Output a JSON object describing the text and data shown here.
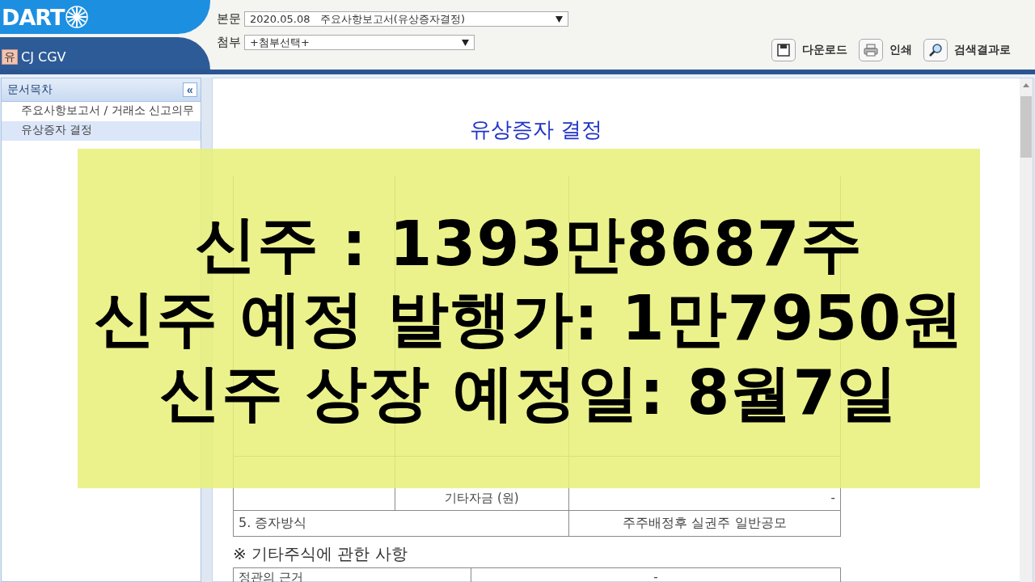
{
  "header": {
    "logo": "DART",
    "company": {
      "badge": "유",
      "name": "CJ CGV"
    },
    "selects": [
      {
        "label": "본문",
        "value": "2020.05.08   주요사항보고서(유상증자결정)",
        "kind": "wide"
      },
      {
        "label": "첨부",
        "value": "+첨부선택+",
        "kind": "narrow"
      }
    ],
    "buttons": [
      {
        "label": "다운로드",
        "kind": "save"
      },
      {
        "label": "인쇄",
        "kind": "print"
      },
      {
        "label": "검색결과로",
        "kind": "search"
      }
    ]
  },
  "sidebar": {
    "title": "문서목차",
    "collapse": "«",
    "items": [
      {
        "label": "주요사항보고서 / 거래소 신고의무",
        "selected": false
      },
      {
        "label": "유상증자 결정",
        "selected": true
      }
    ]
  },
  "document": {
    "title": "유상증자 결정",
    "table": [
      {
        "kind": "covered"
      },
      {
        "kind": "covered"
      },
      {
        "kind": "covered"
      },
      {
        "kind": "covered"
      },
      {
        "kind": "covered"
      },
      {
        "kind": "covered"
      },
      {
        "kind": "covered"
      },
      {
        "kind": "covered"
      },
      {
        "kind": "covered"
      },
      {
        "kind": "covered"
      },
      {
        "kind": "covered"
      },
      {
        "kind": "row",
        "sub": "기타자금 (원)",
        "value": "-"
      },
      {
        "kind": "wide",
        "item": "5. 증자방식",
        "value": "주주배정후 실권주 일반공모"
      }
    ],
    "note": "※ 기타주식에 관한 사항",
    "table2": [
      {
        "item": "정관의 근거",
        "value": "-"
      }
    ]
  },
  "caption": {
    "lines": [
      "신주 : 1393만8687주",
      "신주 예정 발행가: 1만7950원",
      "신주 상장 예정일: 8월7일"
    ]
  }
}
